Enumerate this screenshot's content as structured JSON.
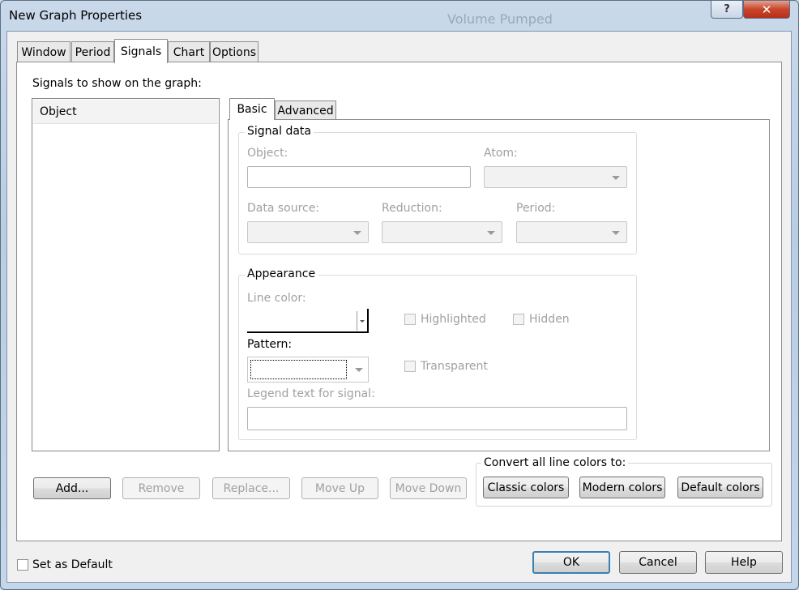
{
  "window": {
    "title": "New Graph Properties",
    "background_title": "Volume Pumped",
    "help_label": "?",
    "close_label": "✕"
  },
  "tabs": [
    {
      "label": "Window",
      "active": false
    },
    {
      "label": "Period",
      "active": false
    },
    {
      "label": "Signals",
      "active": true
    },
    {
      "label": "Chart",
      "active": false
    },
    {
      "label": "Options",
      "active": false
    }
  ],
  "signals": {
    "list_caption": "Signals to show on the graph:",
    "list_header": "Object"
  },
  "subtabs": [
    {
      "label": "Basic",
      "active": true
    },
    {
      "label": "Advanced",
      "active": false
    }
  ],
  "signal_data": {
    "title": "Signal data",
    "object_label": "Object:",
    "object_value": "",
    "atom_label": "Atom:",
    "atom_value": "",
    "data_source_label": "Data source:",
    "data_source_value": "",
    "reduction_label": "Reduction:",
    "reduction_value": "",
    "period_label": "Period:",
    "period_value": ""
  },
  "appearance": {
    "title": "Appearance",
    "line_color_label": "Line color:",
    "line_color": "#000000",
    "highlighted_label": "Highlighted",
    "highlighted_checked": false,
    "hidden_label": "Hidden",
    "hidden_checked": false,
    "pattern_label": "Pattern:",
    "transparent_label": "Transparent",
    "transparent_checked": false,
    "legend_label": "Legend text for signal:",
    "legend_value": ""
  },
  "buttons": {
    "add": "Add...",
    "remove": "Remove",
    "replace": "Replace...",
    "move_up": "Move Up",
    "move_down": "Move Down"
  },
  "convert": {
    "title": "Convert all line colors to:",
    "classic": "Classic colors",
    "modern": "Modern colors",
    "default": "Default colors"
  },
  "footer": {
    "set_default_label": "Set as Default",
    "set_default_checked": false,
    "ok": "OK",
    "cancel": "Cancel",
    "help": "Help"
  },
  "colors": {
    "disabled_text": "#a0a0a0",
    "close_button": "#c8452c",
    "default_button_border": "#3c7fb1"
  }
}
